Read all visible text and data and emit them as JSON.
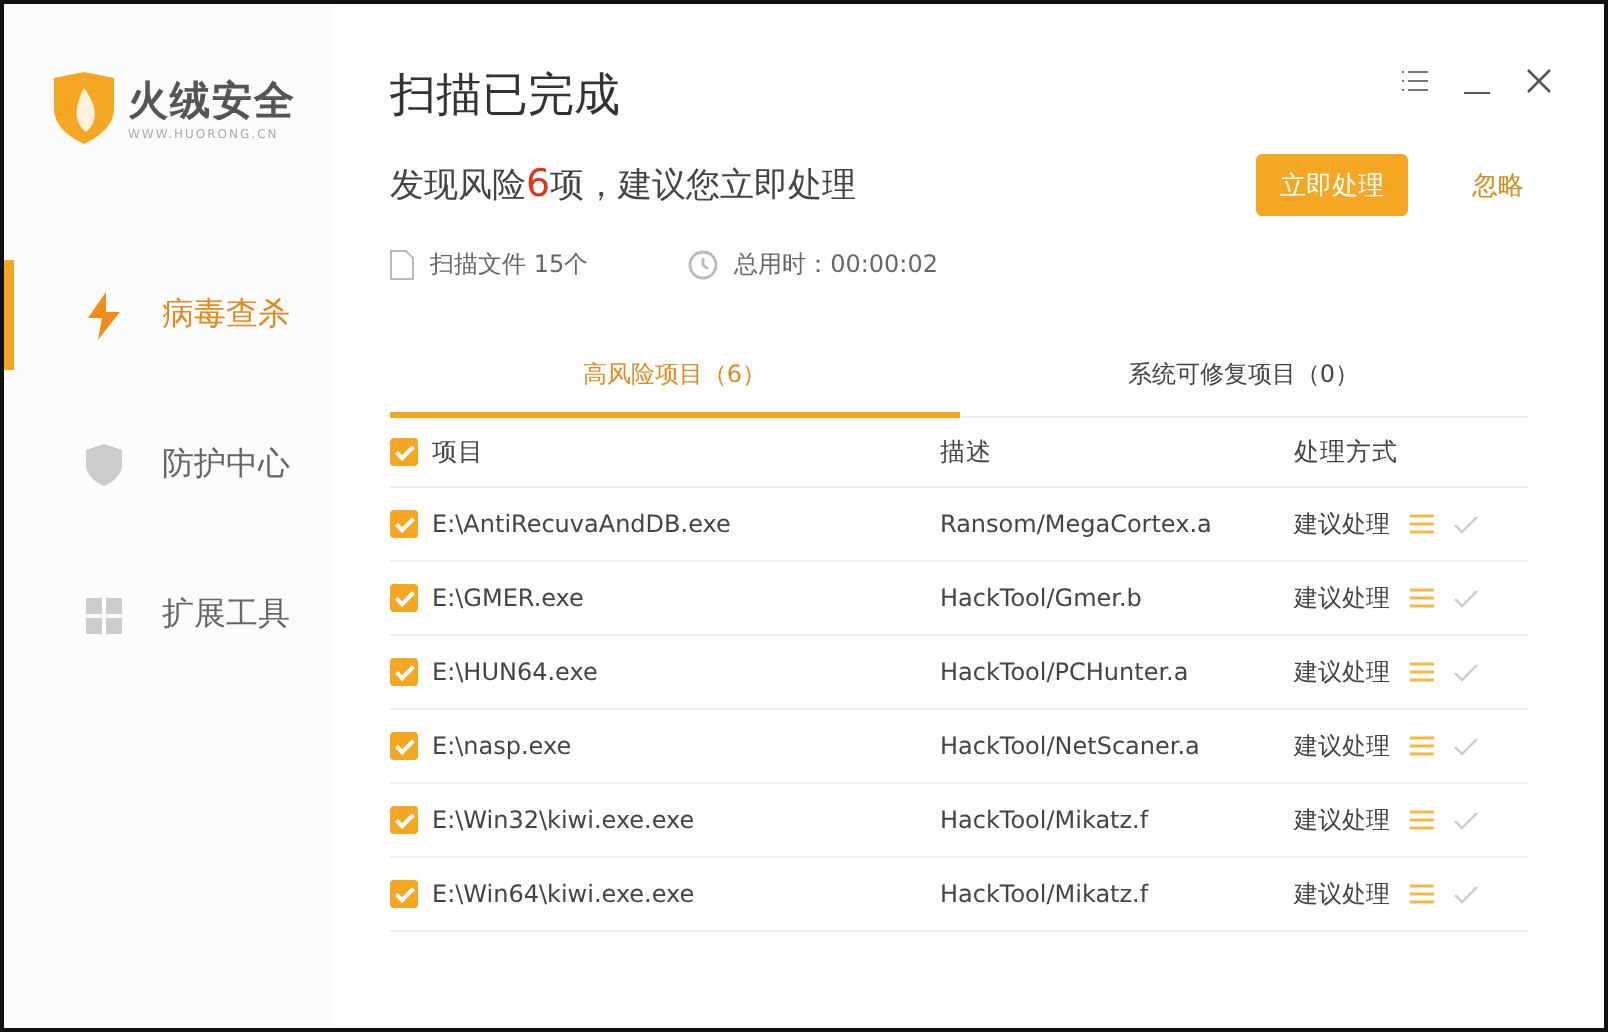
{
  "brand": {
    "name": "火绒安全",
    "url": "WWW.HUORONG.CN"
  },
  "sidebar": {
    "items": [
      {
        "label": "病毒查杀",
        "kind": "bolt",
        "selected": true
      },
      {
        "label": "防护中心",
        "kind": "shield",
        "selected": false
      },
      {
        "label": "扩展工具",
        "kind": "grid",
        "selected": false
      }
    ]
  },
  "header": {
    "title": "扫描已完成",
    "summary": {
      "before": "发现风险",
      "count": "6",
      "after": "项，建议您立即处理"
    },
    "primary_button": "立即处理",
    "ignore_link": "忽略"
  },
  "stats": [
    {
      "kind": "file",
      "label": "扫描文件 15个"
    },
    {
      "kind": "clock",
      "label": "总用时：00:00:02"
    }
  ],
  "tabs": [
    {
      "label": "高风险项目（6）",
      "selected": true
    },
    {
      "label": "系统可修复项目（0）",
      "selected": false
    }
  ],
  "table": {
    "select_all": true,
    "columns": [
      "项目",
      "描述",
      "处理方式"
    ],
    "rows": [
      {
        "checked": true,
        "item": "E:\\AntiRecuvaAndDB.exe",
        "description": "Ransom/MegaCortex.a",
        "action": "建议处理"
      },
      {
        "checked": true,
        "item": "E:\\GMER.exe",
        "description": "HackTool/Gmer.b",
        "action": "建议处理"
      },
      {
        "checked": true,
        "item": "E:\\HUN64.exe",
        "description": "HackTool/PCHunter.a",
        "action": "建议处理"
      },
      {
        "checked": true,
        "item": "E:\\nasp.exe",
        "description": "HackTool/NetScaner.a",
        "action": "建议处理"
      },
      {
        "checked": true,
        "item": "E:\\Win32\\kiwi.exe.exe",
        "description": "HackTool/Mikatz.f",
        "action": "建议处理"
      },
      {
        "checked": true,
        "item": "E:\\Win64\\kiwi.exe.exe",
        "description": "HackTool/Mikatz.f",
        "action": "建议处理"
      }
    ]
  }
}
